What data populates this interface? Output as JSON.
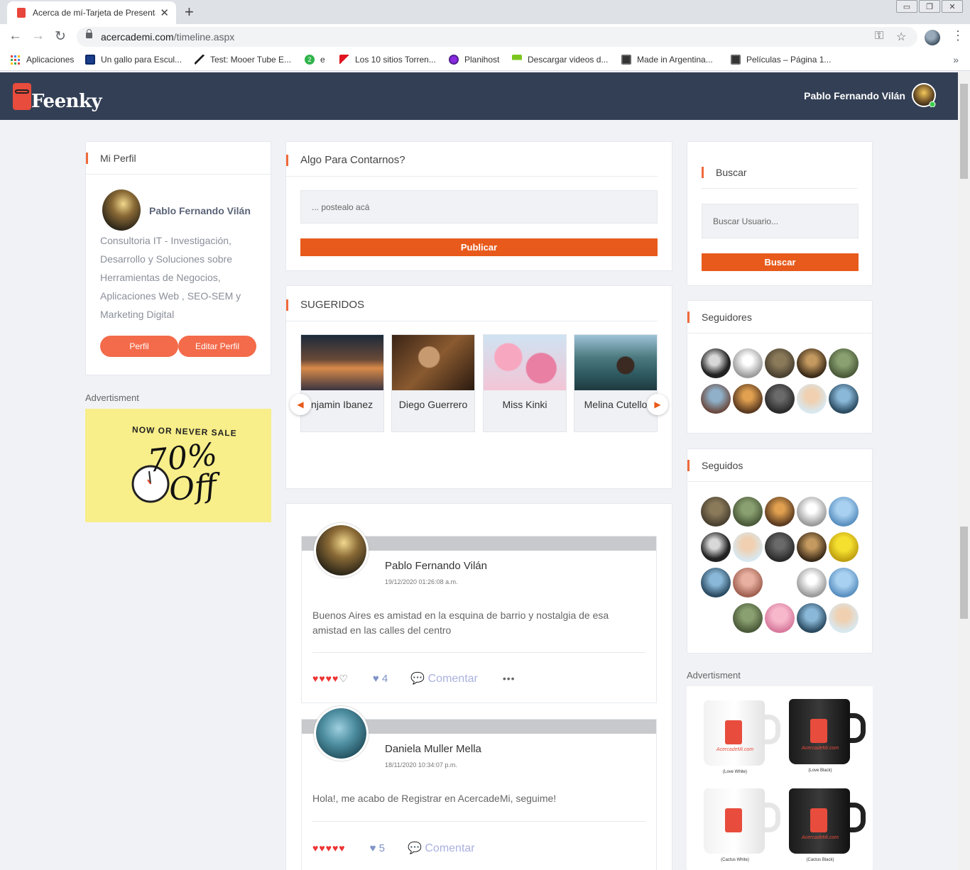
{
  "browser": {
    "tab_title": "Acerca de mí-Tarjeta de Presenta",
    "url_host": "acercademi.com",
    "url_path": "/timeline.aspx",
    "bookmarks": [
      {
        "label": "Aplicaciones",
        "icon": "apps-grid-icon"
      },
      {
        "label": "Un gallo para Escul...",
        "icon": "tv-icon"
      },
      {
        "label": "Test: Mooer Tube E...",
        "icon": "guitar-icon"
      },
      {
        "label": "e",
        "icon": "green-badge-icon"
      },
      {
        "label": "Los 10 sitios Torren...",
        "icon": "red-arrow-icon"
      },
      {
        "label": "Planihost",
        "icon": "planihost-icon"
      },
      {
        "label": "Descargar videos d...",
        "icon": "download-icon"
      },
      {
        "label": "Made in Argentina...",
        "icon": "film-icon"
      },
      {
        "label": "Películas – Página 1...",
        "icon": "film-icon"
      }
    ]
  },
  "header": {
    "logo": "Feenky",
    "user_name": "Pablo Fernando Vilán"
  },
  "profile": {
    "title": "Mi Perfil",
    "name": "Pablo Fernando Vilán",
    "bio": "Consultoria IT - Investigación, Desarrollo y Soluciones sobre Herramientas de Negocios, Aplicaciones Web , SEO-SEM y Marketing Digital",
    "btn_profile": "Perfil",
    "btn_edit": "Editar Perfil"
  },
  "left_ad": {
    "label": "Advertisment",
    "line1": "NOW OR NEVER SALE",
    "line2": "70%",
    "line3": "Off"
  },
  "composer": {
    "title": "Algo Para Contarnos?",
    "placeholder": "... postealo acá",
    "button": "Publicar"
  },
  "suggested": {
    "title": "SUGERIDOS",
    "items": [
      {
        "name": "Benjamin Ibanez"
      },
      {
        "name": "Diego Guerrero"
      },
      {
        "name": "Miss Kinki"
      },
      {
        "name": "Melina Cutello"
      }
    ]
  },
  "posts": [
    {
      "author": "Pablo Fernando Vilán",
      "date": "19/12/2020 01:26:08 a.m.",
      "text": "Buenos Aires es amistad en la esquina de barrio y nostalgia de esa amistad en las calles del centro",
      "rating": 4,
      "likes": "4",
      "comment": "Comentar"
    },
    {
      "author": "Daniela Muller Mella",
      "date": "18/11/2020 10:34:07 p.m.",
      "text": "Hola!, me acabo de Registrar en AcercadeMi, seguime!",
      "rating": 5,
      "likes": "5",
      "comment": "Comentar"
    }
  ],
  "search": {
    "title": "Buscar",
    "placeholder": "Buscar Usuario...",
    "button": "Buscar"
  },
  "followers": {
    "title": "Seguidores"
  },
  "following": {
    "title": "Seguidos"
  },
  "right_ad": {
    "label": "Advertisment",
    "brand": "AcercadeMi.com",
    "mugs": [
      "(Love White)",
      "(Love Black)",
      "(Cactus White)",
      "(Cactus Black)"
    ]
  }
}
